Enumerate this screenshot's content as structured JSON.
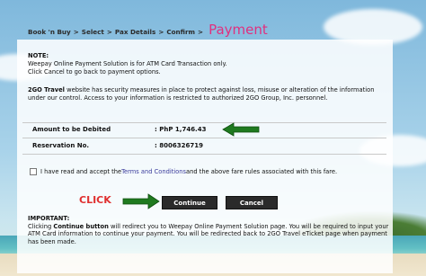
{
  "breadcrumb": {
    "steps": [
      "Book 'n Buy",
      "Select",
      "Pax Details",
      "Confirm"
    ],
    "separator": ">",
    "current": "Payment"
  },
  "note": {
    "heading": "NOTE:",
    "line1": "Weepay Online Payment Solution is for ATM Card Transaction only.",
    "line2": "Click Cancel to go back to payment options."
  },
  "security": {
    "brand": "2GO Travel",
    "text": " website has security measures in place to protect against loss, misuse or alteration of the information under our control. Access to your information is restricted to authorized 2GO Group, Inc. personnel."
  },
  "amount": {
    "label": "Amount to be Debited",
    "value": ": PhP 1,746.43"
  },
  "reservation": {
    "label": "Reservation No.",
    "value": ": 8006326719"
  },
  "terms": {
    "prefix": "I have read and accept the",
    "link": "Terms and Conditions",
    "suffix": " and the above fare rules associated with this fare."
  },
  "actions": {
    "click_label": "CLICK",
    "continue_label": "Continue",
    "cancel_label": "Cancel"
  },
  "important": {
    "heading": "IMPORTANT:",
    "pre": "Clicking ",
    "bold": "Continue button",
    "post": " will redirect you to Weepay Online Payment Solution page. You will be required to input your ATM Card information to continue your payment. You will be redirected back to 2GO Travel eTicket page when payment has been made."
  },
  "colors": {
    "accent": "#e0307f",
    "arrow": "#1f7a1f",
    "click_text": "#e03030",
    "button_bg": "#2a2a2a"
  },
  "icons": {
    "arrows": "green-arrow-icon"
  }
}
